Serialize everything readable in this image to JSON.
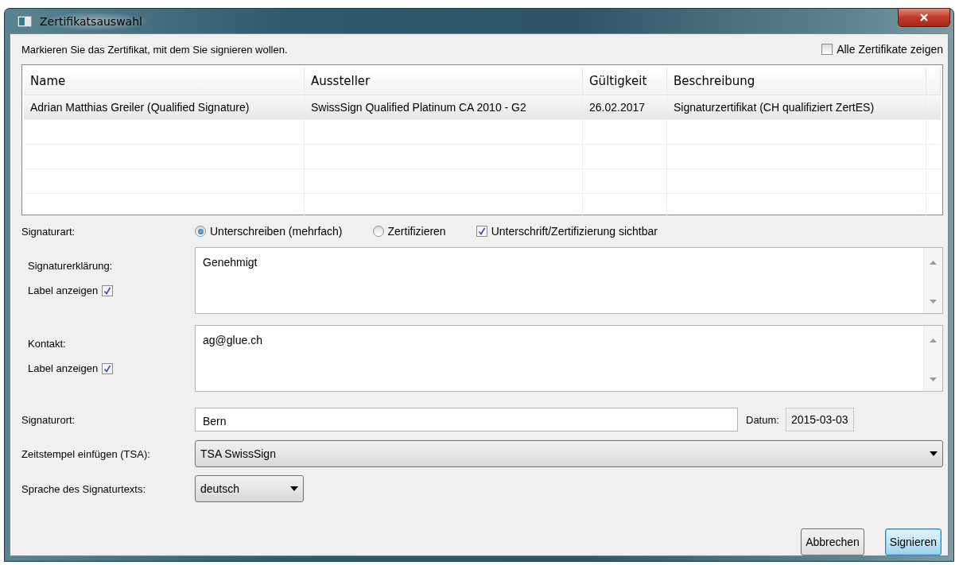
{
  "window": {
    "title": "Zertifikatsauswahl"
  },
  "instruction": "Markieren Sie das Zertifikat, mit dem Sie signieren wollen.",
  "show_all": {
    "label": "Alle Zertifikate zeigen",
    "checked": false
  },
  "table": {
    "columns": [
      "Name",
      "Aussteller",
      "Gültigkeit",
      "Beschreibung"
    ],
    "rows": [
      {
        "cells": [
          "Adrian Matthias Greiler (Qualified Signature)",
          "SwissSign Qualified Platinum CA 2010 - G2",
          "26.02.2017",
          "Signaturzertifikat (CH qualifiziert ZertES)"
        ],
        "selected": true
      }
    ]
  },
  "signature_type": {
    "label": "Signaturart:",
    "options": [
      {
        "label": "Unterschreiben (mehrfach)",
        "selected": true
      },
      {
        "label": "Zertifizieren",
        "selected": false
      }
    ],
    "visible": {
      "label": "Unterschrift/Zertifizierung sichtbar",
      "checked": true
    }
  },
  "text_areas": [
    {
      "label": "Signaturerklärung:",
      "value": "Genehmigt",
      "show_label": {
        "label": "Label anzeigen",
        "checked": true
      }
    },
    {
      "label": "Kontakt:",
      "value": "ag@glue.ch",
      "show_label": {
        "label": "Label anzeigen",
        "checked": true
      }
    }
  ],
  "location": {
    "label": "Signaturort:",
    "value": "Bern"
  },
  "date": {
    "label": "Datum:",
    "value": "2015-03-03"
  },
  "tsa": {
    "label": "Zeitstempel einfügen (TSA):",
    "value": "TSA SwissSign"
  },
  "language": {
    "label": "Sprache des Signaturtexts:",
    "value": "deutsch"
  },
  "buttons": [
    {
      "label": "Abbrechen",
      "default": false
    },
    {
      "label": "Signieren",
      "default": true
    }
  ]
}
